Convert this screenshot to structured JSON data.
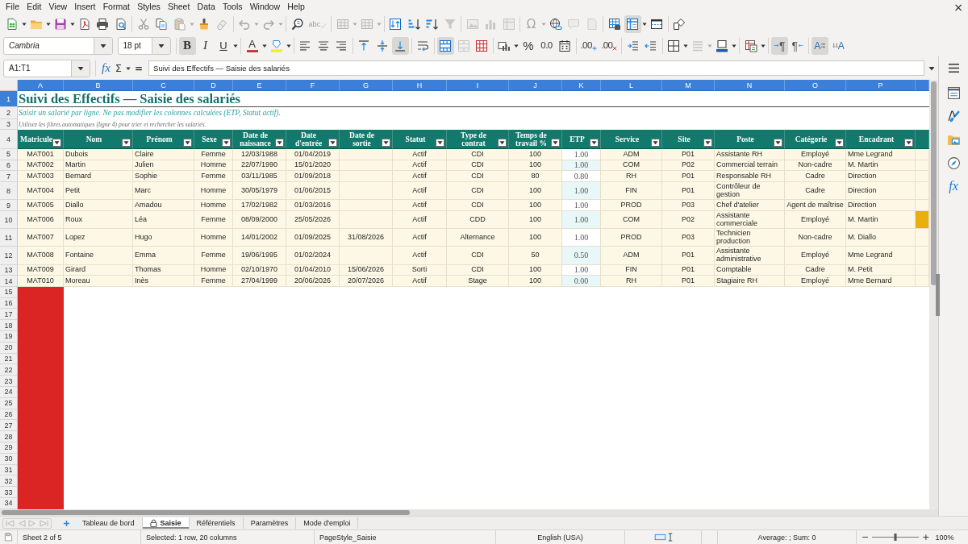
{
  "menu_bar": {
    "items": [
      "File",
      "Edit",
      "View",
      "Insert",
      "Format",
      "Styles",
      "Sheet",
      "Data",
      "Tools",
      "Window",
      "Help"
    ],
    "close": "×"
  },
  "standard_toolbar": {
    "groups": [
      [
        {
          "kind": "new",
          "disabled": false,
          "pressed": false,
          "dropdown": true
        },
        {
          "kind": "open",
          "disabled": false,
          "pressed": false,
          "dropdown": true
        },
        {
          "kind": "save",
          "disabled": false,
          "pressed": false,
          "dropdown": true
        },
        {
          "kind": "pdf",
          "disabled": false,
          "pressed": false,
          "dropdown": false
        },
        {
          "kind": "print",
          "disabled": false,
          "pressed": false,
          "dropdown": false
        },
        {
          "kind": "preview",
          "disabled": false,
          "pressed": false,
          "dropdown": false
        }
      ],
      [
        {
          "kind": "cut",
          "disabled": true,
          "pressed": false,
          "dropdown": false
        },
        {
          "kind": "copy",
          "disabled": false,
          "pressed": false,
          "dropdown": false
        },
        {
          "kind": "paste",
          "disabled": true,
          "pressed": false,
          "dropdown": true
        },
        {
          "kind": "clone",
          "disabled": false,
          "pressed": false,
          "dropdown": false
        },
        {
          "kind": "clear",
          "disabled": true,
          "pressed": false,
          "dropdown": false
        }
      ],
      [
        {
          "kind": "undo",
          "disabled": true,
          "pressed": false,
          "dropdown": true
        },
        {
          "kind": "redo",
          "disabled": true,
          "pressed": false,
          "dropdown": true
        }
      ],
      [
        {
          "kind": "find",
          "disabled": false,
          "pressed": false,
          "dropdown": false
        },
        {
          "kind": "spelling",
          "label": "abc",
          "disabled": true,
          "pressed": false,
          "dropdown": false
        }
      ],
      [
        {
          "kind": "row",
          "disabled": true,
          "pressed": false,
          "dropdown": true
        },
        {
          "kind": "column",
          "disabled": true,
          "pressed": false,
          "dropdown": true
        }
      ],
      [
        {
          "kind": "sort",
          "disabled": false,
          "pressed": false,
          "dropdown": false
        },
        {
          "kind": "ascending",
          "disabled": false,
          "pressed": false,
          "dropdown": false
        },
        {
          "kind": "descending",
          "disabled": false,
          "pressed": false,
          "dropdown": false
        },
        {
          "kind": "autofilter",
          "disabled": true,
          "pressed": false,
          "dropdown": false
        }
      ],
      [
        {
          "kind": "image",
          "disabled": true,
          "pressed": false,
          "dropdown": false
        },
        {
          "kind": "chart",
          "disabled": true,
          "pressed": false,
          "dropdown": false
        },
        {
          "kind": "pivot",
          "disabled": true,
          "pressed": false,
          "dropdown": false
        }
      ],
      [
        {
          "kind": "special",
          "label": "Ω",
          "disabled": true,
          "pressed": false,
          "dropdown": true
        },
        {
          "kind": "hyperlink",
          "disabled": false,
          "pressed": false,
          "dropdown": false
        },
        {
          "kind": "comment",
          "disabled": true,
          "pressed": false,
          "dropdown": false
        },
        {
          "kind": "headers",
          "disabled": true,
          "pressed": false,
          "dropdown": false
        }
      ],
      [
        {
          "kind": "printarea",
          "disabled": false,
          "pressed": false,
          "dropdown": false
        },
        {
          "kind": "freeze",
          "disabled": false,
          "pressed": true,
          "dropdown": true
        },
        {
          "kind": "split",
          "disabled": false,
          "pressed": false,
          "dropdown": false
        }
      ],
      [
        {
          "kind": "draw",
          "disabled": false,
          "pressed": false,
          "dropdown": false
        }
      ]
    ]
  },
  "formatting_toolbar": {
    "font_name": "Cambria",
    "font_size": "18 pt",
    "groups": [
      [
        {
          "kind": "bold",
          "label": "B",
          "disabled": false,
          "pressed": true,
          "dropdown": false
        },
        {
          "kind": "italic",
          "label": "I",
          "disabled": false,
          "pressed": false,
          "dropdown": false
        },
        {
          "kind": "underline",
          "label": "U",
          "disabled": false,
          "pressed": false,
          "dropdown": true
        }
      ],
      [
        {
          "kind": "fontcolor",
          "label": "A",
          "disabled": false,
          "pressed": false,
          "dropdown": true
        },
        {
          "kind": "highlight",
          "disabled": false,
          "pressed": false,
          "dropdown": true
        }
      ],
      [
        {
          "kind": "left",
          "disabled": false,
          "pressed": false,
          "dropdown": false
        },
        {
          "kind": "center",
          "disabled": false,
          "pressed": false,
          "dropdown": false
        },
        {
          "kind": "right",
          "disabled": false,
          "pressed": false,
          "dropdown": false
        }
      ],
      [
        {
          "kind": "top",
          "disabled": false,
          "pressed": false,
          "dropdown": false
        },
        {
          "kind": "middle",
          "disabled": false,
          "pressed": false,
          "dropdown": false
        },
        {
          "kind": "bottom",
          "disabled": false,
          "pressed": true,
          "dropdown": false
        }
      ],
      [
        {
          "kind": "wrap",
          "disabled": false,
          "pressed": false,
          "dropdown": false
        }
      ],
      [
        {
          "kind": "mergecenter",
          "disabled": false,
          "pressed": true,
          "dropdown": false
        },
        {
          "kind": "merge",
          "disabled": true,
          "pressed": false,
          "dropdown": false
        },
        {
          "kind": "unmerge",
          "disabled": false,
          "pressed": false,
          "dropdown": false
        }
      ],
      [
        {
          "kind": "numberformat",
          "disabled": false,
          "pressed": false,
          "dropdown": true
        },
        {
          "kind": "percent",
          "label": "%",
          "disabled": false,
          "pressed": false,
          "dropdown": false
        },
        {
          "kind": "standard",
          "label": "0.0",
          "disabled": false,
          "pressed": false,
          "dropdown": false
        },
        {
          "kind": "date",
          "disabled": false,
          "pressed": false,
          "dropdown": false
        }
      ],
      [
        {
          "kind": "adddecimal",
          "label": ".00",
          "disabled": false,
          "pressed": false,
          "dropdown": false
        },
        {
          "kind": "deletedecimal",
          "label": ".00",
          "disabled": false,
          "pressed": false,
          "dropdown": false
        }
      ],
      [
        {
          "kind": "indent",
          "disabled": false,
          "pressed": false,
          "dropdown": false
        },
        {
          "kind": "outdent",
          "disabled": false,
          "pressed": false,
          "dropdown": false
        }
      ],
      [
        {
          "kind": "borders",
          "disabled": false,
          "pressed": false,
          "dropdown": true
        },
        {
          "kind": "borderstyle",
          "disabled": true,
          "pressed": false,
          "dropdown": true
        },
        {
          "kind": "bordercolor",
          "disabled": false,
          "pressed": false,
          "dropdown": true
        }
      ],
      [
        {
          "kind": "conditional",
          "disabled": false,
          "pressed": false,
          "dropdown": true
        }
      ],
      [
        {
          "kind": "ltr",
          "label": "¶",
          "disabled": false,
          "pressed": true,
          "dropdown": false
        },
        {
          "kind": "rtl",
          "label": "¶",
          "disabled": false,
          "pressed": false,
          "dropdown": false
        }
      ],
      [
        {
          "kind": "direction",
          "label": "A",
          "disabled": false,
          "pressed": true,
          "dropdown": false
        },
        {
          "kind": "stacked",
          "label": "A",
          "disabled": false,
          "pressed": false,
          "dropdown": false
        }
      ]
    ]
  },
  "formula_bar": {
    "name_box": "A1:T1",
    "function_wizard": "fx",
    "sum": "Σ",
    "formula": "=",
    "content": "Suivi des Effectifs — Saisie des salariés"
  },
  "sheet": {
    "columns": [
      {
        "letter": "A",
        "selected": true
      },
      {
        "letter": "B",
        "selected": true
      },
      {
        "letter": "C",
        "selected": true
      },
      {
        "letter": "D",
        "selected": true
      },
      {
        "letter": "E",
        "selected": true
      },
      {
        "letter": "F",
        "selected": true
      },
      {
        "letter": "G",
        "selected": true
      },
      {
        "letter": "H",
        "selected": true
      },
      {
        "letter": "I",
        "selected": true
      },
      {
        "letter": "J",
        "selected": true
      },
      {
        "letter": "K",
        "selected": true
      },
      {
        "letter": "L",
        "selected": true
      },
      {
        "letter": "M",
        "selected": true
      },
      {
        "letter": "N",
        "selected": true
      },
      {
        "letter": "O",
        "selected": true
      },
      {
        "letter": "P",
        "selected": true
      },
      {
        "selected": true
      }
    ],
    "title_rows": [
      {
        "number": "1",
        "selected": true,
        "text": "Suivi des Effectifs — Saisie des salariés"
      },
      {
        "number": "2",
        "selected": false,
        "text": "Saisir un salarié par ligne. Ne pas modifier les colonnes calculées (ETP, Statut actif)."
      },
      {
        "number": "3",
        "selected": false,
        "text": "Utilisez les filtres automatiques (ligne 4) pour trier et rechercher les salariés."
      }
    ],
    "header_row": {
      "number": "4",
      "selected": false,
      "cells": [
        {
          "text": "Matricule",
          "filter": true
        },
        {
          "text": "Nom",
          "filter": true
        },
        {
          "text": "Prénom",
          "filter": true
        },
        {
          "text": "Sexe",
          "filter": true
        },
        {
          "text": "Date de naissance",
          "filter": true
        },
        {
          "text": "Date d'entrée",
          "filter": true
        },
        {
          "text": "Date de sortie",
          "filter": true
        },
        {
          "text": "Statut",
          "filter": true
        },
        {
          "text": "Type de contrat",
          "filter": true
        },
        {
          "text": "Temps de travail %",
          "filter": true
        },
        {
          "text": "ETP",
          "filter": true
        },
        {
          "text": "Service",
          "filter": true
        },
        {
          "text": "Site",
          "filter": true
        },
        {
          "text": "Poste",
          "filter": true
        },
        {
          "text": "Catégorie",
          "filter": true
        },
        {
          "text": "Encadrant",
          "filter": true
        },
        {
          "filter": false
        }
      ]
    },
    "data_rows": [
      {
        "number": "5",
        "selected": false,
        "cells": [
          {
            "text": "MAT001"
          },
          {
            "text": "Dubois"
          },
          {
            "text": "Claire"
          },
          {
            "text": "Femme"
          },
          {
            "text": "12/03/1988"
          },
          {
            "text": "01/04/2019"
          },
          {},
          {
            "text": "Actif"
          },
          {
            "text": "CDI"
          },
          {
            "text": "100"
          },
          {
            "text": "1.00"
          },
          {
            "text": "ADM"
          },
          {
            "text": "P01"
          },
          {
            "text": "Assistante RH"
          },
          {
            "text": "Employé"
          },
          {
            "text": "Mme Legrand"
          }
        ],
        "last_cell_highlighted": false
      },
      {
        "number": "6",
        "selected": false,
        "cells": [
          {
            "text": "MAT002"
          },
          {
            "text": "Martin"
          },
          {
            "text": "Julien"
          },
          {
            "text": "Homme"
          },
          {
            "text": "22/07/1990"
          },
          {
            "text": "15/01/2020"
          },
          {},
          {
            "text": "Actif"
          },
          {
            "text": "CDI"
          },
          {
            "text": "100"
          },
          {
            "text": "1.00"
          },
          {
            "text": "COM"
          },
          {
            "text": "P02"
          },
          {
            "text": "Commercial terrain"
          },
          {
            "text": "Non-cadre"
          },
          {
            "text": "M. Martin"
          }
        ],
        "last_cell_highlighted": false
      },
      {
        "number": "7",
        "selected": false,
        "cells": [
          {
            "text": "MAT003"
          },
          {
            "text": "Bernard"
          },
          {
            "text": "Sophie"
          },
          {
            "text": "Femme"
          },
          {
            "text": "03/11/1985"
          },
          {
            "text": "01/09/2018"
          },
          {},
          {
            "text": "Actif"
          },
          {
            "text": "CDI"
          },
          {
            "text": "80"
          },
          {
            "text": "0.80"
          },
          {
            "text": "RH"
          },
          {
            "text": "P01"
          },
          {
            "text": "Responsable RH"
          },
          {
            "text": "Cadre"
          },
          {
            "text": "Direction"
          }
        ],
        "last_cell_highlighted": false
      },
      {
        "number": "8",
        "selected": false,
        "cells": [
          {
            "text": "MAT004"
          },
          {
            "text": "Petit"
          },
          {
            "text": "Marc"
          },
          {
            "text": "Homme"
          },
          {
            "text": "30/05/1979"
          },
          {
            "text": "01/06/2015"
          },
          {},
          {
            "text": "Actif"
          },
          {
            "text": "CDI"
          },
          {
            "text": "100"
          },
          {
            "text": "1.00"
          },
          {
            "text": "FIN"
          },
          {
            "text": "P01"
          },
          {
            "text": "Contrôleur de gestion"
          },
          {
            "text": "Cadre"
          },
          {
            "text": "Direction"
          }
        ],
        "last_cell_highlighted": false
      },
      {
        "number": "9",
        "selected": false,
        "cells": [
          {
            "text": "MAT005"
          },
          {
            "text": "Diallo"
          },
          {
            "text": "Amadou"
          },
          {
            "text": "Homme"
          },
          {
            "text": "17/02/1982"
          },
          {
            "text": "01/03/2016"
          },
          {},
          {
            "text": "Actif"
          },
          {
            "text": "CDI"
          },
          {
            "text": "100"
          },
          {
            "text": "1.00"
          },
          {
            "text": "PROD"
          },
          {
            "text": "P03"
          },
          {
            "text": "Chef d'atelier"
          },
          {
            "text": "Agent de maîtrise"
          },
          {
            "text": "Direction"
          }
        ],
        "last_cell_highlighted": false
      },
      {
        "number": "10",
        "selected": false,
        "cells": [
          {
            "text": "MAT006"
          },
          {
            "text": "Roux"
          },
          {
            "text": "Léa"
          },
          {
            "text": "Femme"
          },
          {
            "text": "08/09/2000"
          },
          {
            "text": "25/05/2026"
          },
          {},
          {
            "text": "Actif"
          },
          {
            "text": "CDD"
          },
          {
            "text": "100"
          },
          {
            "text": "1.00"
          },
          {
            "text": "COM"
          },
          {
            "text": "P02"
          },
          {
            "text": "Assistante commerciale"
          },
          {
            "text": "Employé"
          },
          {
            "text": "M. Martin"
          }
        ],
        "last_cell_highlighted": true
      },
      {
        "number": "11",
        "selected": false,
        "cells": [
          {
            "text": "MAT007"
          },
          {
            "text": "Lopez"
          },
          {
            "text": "Hugo"
          },
          {
            "text": "Homme"
          },
          {
            "text": "14/01/2002"
          },
          {
            "text": "01/09/2025"
          },
          {
            "text": "31/08/2026"
          },
          {
            "text": "Actif"
          },
          {
            "text": "Alternance"
          },
          {
            "text": "100"
          },
          {
            "text": "1.00"
          },
          {
            "text": "PROD"
          },
          {
            "text": "P03"
          },
          {
            "text": "Technicien production"
          },
          {
            "text": "Non-cadre"
          },
          {
            "text": "M. Diallo"
          }
        ],
        "last_cell_highlighted": false
      },
      {
        "number": "12",
        "selected": false,
        "cells": [
          {
            "text": "MAT008"
          },
          {
            "text": "Fontaine"
          },
          {
            "text": "Emma"
          },
          {
            "text": "Femme"
          },
          {
            "text": "19/06/1995"
          },
          {
            "text": "01/02/2024"
          },
          {},
          {
            "text": "Actif"
          },
          {
            "text": "CDI"
          },
          {
            "text": "50"
          },
          {
            "text": "0.50"
          },
          {
            "text": "ADM"
          },
          {
            "text": "P01"
          },
          {
            "text": "Assistante administrative"
          },
          {
            "text": "Employé"
          },
          {
            "text": "Mme Legrand"
          }
        ],
        "last_cell_highlighted": false
      },
      {
        "number": "13",
        "selected": false,
        "cells": [
          {
            "text": "MAT009"
          },
          {
            "text": "Girard"
          },
          {
            "text": "Thomas"
          },
          {
            "text": "Homme"
          },
          {
            "text": "02/10/1970"
          },
          {
            "text": "01/04/2010"
          },
          {
            "text": "15/06/2026"
          },
          {
            "text": "Sorti"
          },
          {
            "text": "CDI"
          },
          {
            "text": "100"
          },
          {
            "text": "1.00"
          },
          {
            "text": "FIN"
          },
          {
            "text": "P01"
          },
          {
            "text": "Comptable"
          },
          {
            "text": "Cadre"
          },
          {
            "text": "M. Petit"
          }
        ],
        "last_cell_highlighted": false
      },
      {
        "number": "14",
        "selected": false,
        "cells": [
          {
            "text": "MAT010"
          },
          {
            "text": "Moreau"
          },
          {
            "text": "Inès"
          },
          {
            "text": "Femme"
          },
          {
            "text": "27/04/1999"
          },
          {
            "text": "20/06/2026"
          },
          {
            "text": "20/07/2026"
          },
          {
            "text": "Actif"
          },
          {
            "text": "Stage"
          },
          {
            "text": "100"
          },
          {
            "text": "0.00"
          },
          {
            "text": "RH"
          },
          {
            "text": "P01"
          },
          {
            "text": "Stagiaire RH"
          },
          {
            "text": "Employé"
          },
          {
            "text": "Mme Bernard"
          }
        ],
        "last_cell_highlighted": false
      }
    ],
    "empty_rows": [
      {
        "number": "15",
        "selected": false,
        "column_a_flagged": true
      },
      {
        "number": "16",
        "selected": false,
        "column_a_flagged": true
      },
      {
        "number": "17",
        "selected": false,
        "column_a_flagged": true
      },
      {
        "number": "18",
        "selected": false,
        "column_a_flagged": true
      },
      {
        "number": "19",
        "selected": false,
        "column_a_flagged": true
      },
      {
        "number": "20",
        "selected": false,
        "column_a_flagged": true
      },
      {
        "number": "21",
        "selected": false,
        "column_a_flagged": true
      },
      {
        "number": "22",
        "selected": false,
        "column_a_flagged": true
      },
      {
        "number": "23",
        "selected": false,
        "column_a_flagged": true
      },
      {
        "number": "24",
        "selected": false,
        "column_a_flagged": true
      },
      {
        "number": "25",
        "selected": false,
        "column_a_flagged": true
      },
      {
        "number": "26",
        "selected": false,
        "column_a_flagged": true
      },
      {
        "number": "27",
        "selected": false,
        "column_a_flagged": true
      },
      {
        "number": "28",
        "selected": false,
        "column_a_flagged": true
      },
      {
        "number": "29",
        "selected": false,
        "column_a_flagged": true
      },
      {
        "number": "30",
        "selected": false,
        "column_a_flagged": true
      },
      {
        "number": "31",
        "selected": false,
        "column_a_flagged": true
      },
      {
        "number": "32",
        "selected": false,
        "column_a_flagged": true
      },
      {
        "number": "33",
        "selected": false,
        "column_a_flagged": true
      },
      {
        "number": "34",
        "selected": false,
        "column_a_flagged": true
      }
    ]
  },
  "sidebar": {
    "tabs": [
      {
        "kind": "properties"
      },
      {
        "kind": "styles"
      },
      {
        "kind": "gallery"
      },
      {
        "kind": "navigator"
      },
      {
        "kind": "functions",
        "label": "fx"
      }
    ]
  },
  "sheet_tabs": [
    {
      "label": "Tableau de bord",
      "selected": false,
      "locked": false
    },
    {
      "label": "Saisie",
      "selected": true,
      "locked": true
    },
    {
      "label": "Référentiels",
      "selected": false,
      "locked": false
    },
    {
      "label": "Paramètres",
      "selected": false,
      "locked": false
    },
    {
      "label": "Mode d'emploi",
      "selected": false,
      "locked": false
    }
  ],
  "status_bar": {
    "sheet": "Sheet 2 of 5",
    "selection": "Selected: 1 row, 20 columns",
    "page_style": "PageStyle_Saisie",
    "language": "English (USA)",
    "summary": "Average: ; Sum: 0",
    "zoom_out": "−",
    "zoom_slider": {
      "level": 0.5
    },
    "zoom_in": "+",
    "zoom": "100%"
  }
}
